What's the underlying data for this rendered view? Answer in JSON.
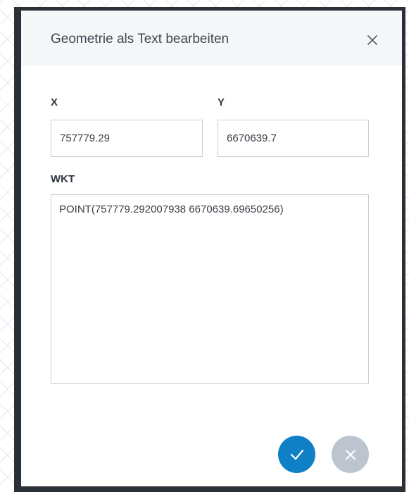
{
  "dialog": {
    "title": "Geometrie als Text bearbeiten",
    "close_icon": "close-icon"
  },
  "fields": {
    "x": {
      "label": "X",
      "value": "757779.29"
    },
    "y": {
      "label": "Y",
      "value": "6670639.7"
    },
    "wkt": {
      "label": "WKT",
      "value": "POINT(757779.292007938 6670639.69650256)"
    }
  },
  "actions": {
    "confirm": {
      "icon": "checkmark-icon",
      "color": "#0f7fc6"
    },
    "cancel": {
      "icon": "close-icon",
      "color": "#bcc5cd"
    }
  },
  "colors": {
    "backdrop": "#2b2f36",
    "header_bg": "#f5f6f8",
    "title_text": "#3f4651",
    "input_border": "#c9ced6"
  }
}
